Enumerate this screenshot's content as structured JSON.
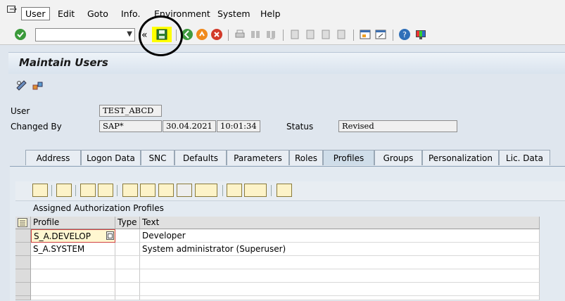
{
  "menu": {
    "items": [
      {
        "label": "User"
      },
      {
        "label": "Edit"
      },
      {
        "label": "Goto"
      },
      {
        "label": "Info."
      },
      {
        "label": "Environment"
      },
      {
        "label": "System"
      },
      {
        "label": "Help"
      }
    ]
  },
  "toolbar": {
    "command_field": "",
    "collapse_glyph": "«"
  },
  "page": {
    "title": "Maintain Users"
  },
  "form": {
    "user_label": "User",
    "user_value": "TEST_ABCD",
    "changed_by_label": "Changed By",
    "changed_by_value": "SAP*",
    "date_value": "30.04.2021",
    "time_value": "10:01:34",
    "status_label": "Status",
    "status_value": "Revised"
  },
  "tabs": [
    {
      "label": "Address",
      "active": false
    },
    {
      "label": "Logon Data",
      "active": false
    },
    {
      "label": "SNC",
      "active": false
    },
    {
      "label": "Defaults",
      "active": false
    },
    {
      "label": "Parameters",
      "active": false
    },
    {
      "label": "Roles",
      "active": false
    },
    {
      "label": "Profiles",
      "active": true
    },
    {
      "label": "Groups",
      "active": false
    },
    {
      "label": "Personalization",
      "active": false
    },
    {
      "label": "Lic. Data",
      "active": false
    }
  ],
  "grid": {
    "title": "Assigned Authorization Profiles",
    "columns": [
      "Profile",
      "Type",
      "Text"
    ],
    "rows": [
      {
        "profile": "S_A.DEVELOP",
        "type": "",
        "text": "Developer"
      },
      {
        "profile": "S_A.SYSTEM",
        "type": "",
        "text": "System administrator (Superuser)"
      }
    ]
  },
  "colors": {
    "highlight": "#ffff00",
    "save_icon": "#2e7d32",
    "active_tab": "#cfdde9"
  }
}
